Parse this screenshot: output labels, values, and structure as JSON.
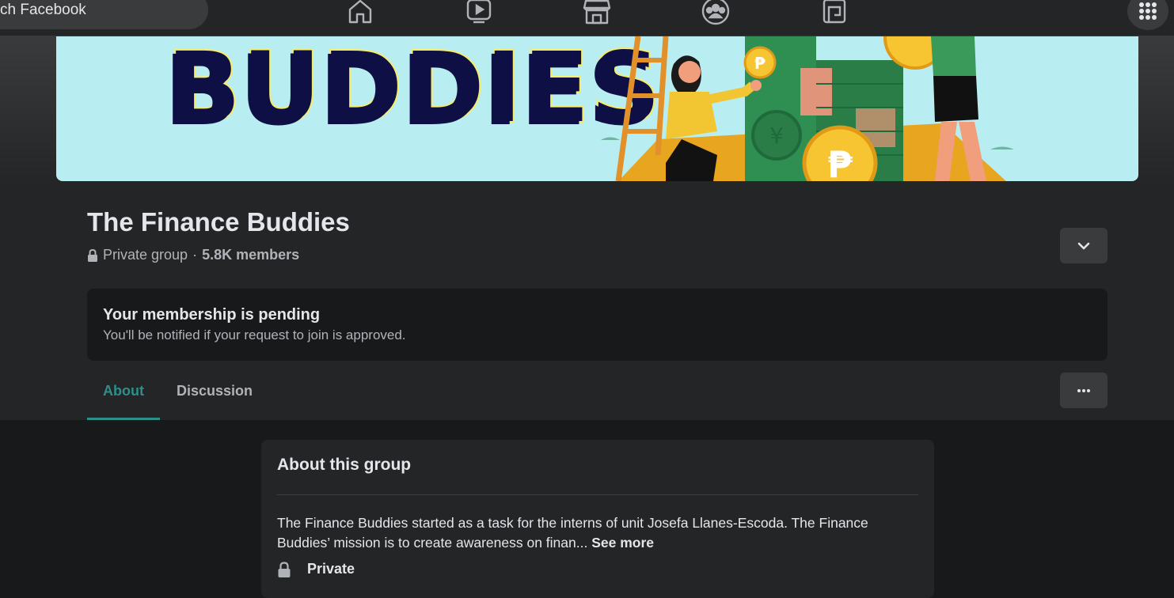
{
  "topbar": {
    "search_placeholder": "Search Facebook",
    "search_visible_text": "ch Facebook",
    "nav_icons": [
      "home-icon",
      "watch-icon",
      "marketplace-icon",
      "groups-icon",
      "gaming-icon"
    ],
    "menu_icon": "grid-menu-icon"
  },
  "cover": {
    "title_text": "BUDDIES",
    "colors": {
      "background": "#b8eef2",
      "title": "#0d0f45",
      "title_outline": "#f5ec6b"
    }
  },
  "group": {
    "name": "The Finance Buddies",
    "privacy": "Private group",
    "separator": "·",
    "members": "5.8K members"
  },
  "pending": {
    "title": "Your membership is pending",
    "subtitle": "You'll be notified if your request to join is approved."
  },
  "tabs": [
    {
      "label": "About",
      "active": true
    },
    {
      "label": "Discussion",
      "active": false
    }
  ],
  "about": {
    "title": "About this group",
    "description": "The Finance Buddies started as a task for the interns of unit Josefa Llanes-Escoda. The Finance Buddies’ mission is to create awareness on finan...",
    "see_more": "See more",
    "privacy_label": "Private"
  },
  "colors": {
    "accent": "#2d8f8a",
    "surface": "#242526",
    "background": "#18191a",
    "button": "#3a3b3c"
  }
}
